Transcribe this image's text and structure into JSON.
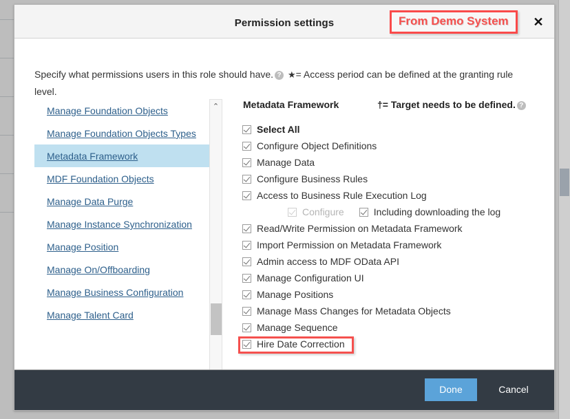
{
  "dialog": {
    "title": "Permission settings",
    "annotation": "From Demo System",
    "close_label": "✕",
    "description_part1": "Specify what permissions users in this role should have.",
    "help_icon_glyph": "?",
    "star_glyph": "★",
    "description_part2": "= Access period can be defined at the granting rule level."
  },
  "sidebar": {
    "items": [
      {
        "label": "Manage Foundation Objects",
        "selected": false
      },
      {
        "label": "Manage Foundation Objects Types",
        "selected": false
      },
      {
        "label": "Metadata Framework",
        "selected": true
      },
      {
        "label": "MDF Foundation Objects",
        "selected": false
      },
      {
        "label": "Manage Data Purge",
        "selected": false
      },
      {
        "label": "Manage Instance Synchronization",
        "selected": false
      },
      {
        "label": "Manage Position",
        "selected": false
      },
      {
        "label": "Manage On/Offboarding",
        "selected": false
      },
      {
        "label": "Manage Business Configuration",
        "selected": false
      },
      {
        "label": "Manage Talent Card",
        "selected": false
      }
    ],
    "scroll_up_glyph": "⌃",
    "scroll_down_glyph": "⌄"
  },
  "permissions": {
    "section_title": "Metadata Framework",
    "dagger_note": "†= Target needs to be defined.",
    "dagger_help_glyph": "?",
    "items": [
      {
        "label": "Select All",
        "checked": true,
        "bold": true,
        "indented": false,
        "disabled": false,
        "annotated": false
      },
      {
        "label": "Configure Object Definitions",
        "checked": true,
        "bold": false,
        "indented": false,
        "disabled": false,
        "annotated": false
      },
      {
        "label": "Manage Data",
        "checked": true,
        "bold": false,
        "indented": false,
        "disabled": false,
        "annotated": false
      },
      {
        "label": "Configure Business Rules",
        "checked": true,
        "bold": false,
        "indented": false,
        "disabled": false,
        "annotated": false
      },
      {
        "label": "Access to Business Rule Execution Log",
        "checked": true,
        "bold": false,
        "indented": false,
        "disabled": false,
        "annotated": false
      }
    ],
    "sub_row": {
      "configure_label": "Configure",
      "configure_checked": true,
      "configure_disabled": true,
      "including_label": "Including downloading the log",
      "including_checked": true
    },
    "items_after": [
      {
        "label": "Read/Write Permission on Metadata Framework",
        "checked": true,
        "bold": false,
        "disabled": false,
        "annotated": false
      },
      {
        "label": "Import Permission on Metadata Framework",
        "checked": true,
        "bold": false,
        "disabled": false,
        "annotated": false
      },
      {
        "label": "Admin access to MDF OData API",
        "checked": true,
        "bold": false,
        "disabled": false,
        "annotated": false
      },
      {
        "label": "Manage Configuration UI",
        "checked": true,
        "bold": false,
        "disabled": false,
        "annotated": false
      },
      {
        "label": "Manage Positions",
        "checked": true,
        "bold": false,
        "disabled": false,
        "annotated": false
      },
      {
        "label": "Manage Mass Changes for Metadata Objects",
        "checked": true,
        "bold": false,
        "disabled": false,
        "annotated": false
      },
      {
        "label": "Manage Sequence",
        "checked": true,
        "bold": false,
        "disabled": false,
        "annotated": false
      },
      {
        "label": "Hire Date Correction",
        "checked": true,
        "bold": false,
        "disabled": false,
        "annotated": true
      }
    ]
  },
  "footer": {
    "done_label": "Done",
    "cancel_label": "Cancel"
  },
  "colors": {
    "accent_blue": "#5ba3d9",
    "annotation_red": "#f5504e",
    "selected_nav": "#bfe0f0",
    "footer_bg": "#333b44",
    "link_blue": "#2d5f8b"
  }
}
